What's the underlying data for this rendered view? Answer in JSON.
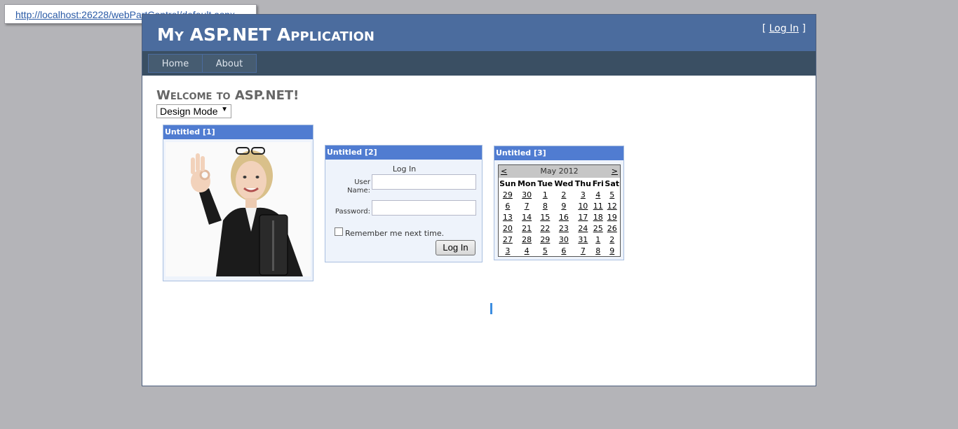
{
  "tooltip": {
    "url": "http://localhost:26228/webPartControl/default.aspx"
  },
  "header": {
    "title": "My ASP.NET Application",
    "login_prefix": "[ ",
    "login_link": "Log In",
    "login_suffix": " ]"
  },
  "menu": {
    "items": [
      {
        "label": "Home"
      },
      {
        "label": "About"
      }
    ]
  },
  "main": {
    "heading": "Welcome to ASP.NET!",
    "mode_select": {
      "value": "Design Mode"
    }
  },
  "parts": {
    "image": {
      "title": "Untitled [1]"
    },
    "login": {
      "title": "Untitled [2]",
      "heading": "Log In",
      "username_label_1": "User",
      "username_label_2": "Name:",
      "password_label": "Password:",
      "remember_label": "Remember me next time.",
      "button": "Log In"
    },
    "calendar": {
      "title": "Untitled [3]",
      "prev": "<",
      "next": ">",
      "month": "May 2012",
      "days": [
        "Sun",
        "Mon",
        "Tue",
        "Wed",
        "Thu",
        "Fri",
        "Sat"
      ],
      "weeks": [
        [
          "29",
          "30",
          "1",
          "2",
          "3",
          "4",
          "5"
        ],
        [
          "6",
          "7",
          "8",
          "9",
          "10",
          "11",
          "12"
        ],
        [
          "13",
          "14",
          "15",
          "16",
          "17",
          "18",
          "19"
        ],
        [
          "20",
          "21",
          "22",
          "23",
          "24",
          "25",
          "26"
        ],
        [
          "27",
          "28",
          "29",
          "30",
          "31",
          "1",
          "2"
        ],
        [
          "3",
          "4",
          "5",
          "6",
          "7",
          "8",
          "9"
        ]
      ]
    }
  },
  "colors": {
    "header_bg": "#4b6c9e",
    "menu_bg": "#3a4f63",
    "part_title_bg": "#507cd1",
    "part_bg": "#eef3fb"
  }
}
